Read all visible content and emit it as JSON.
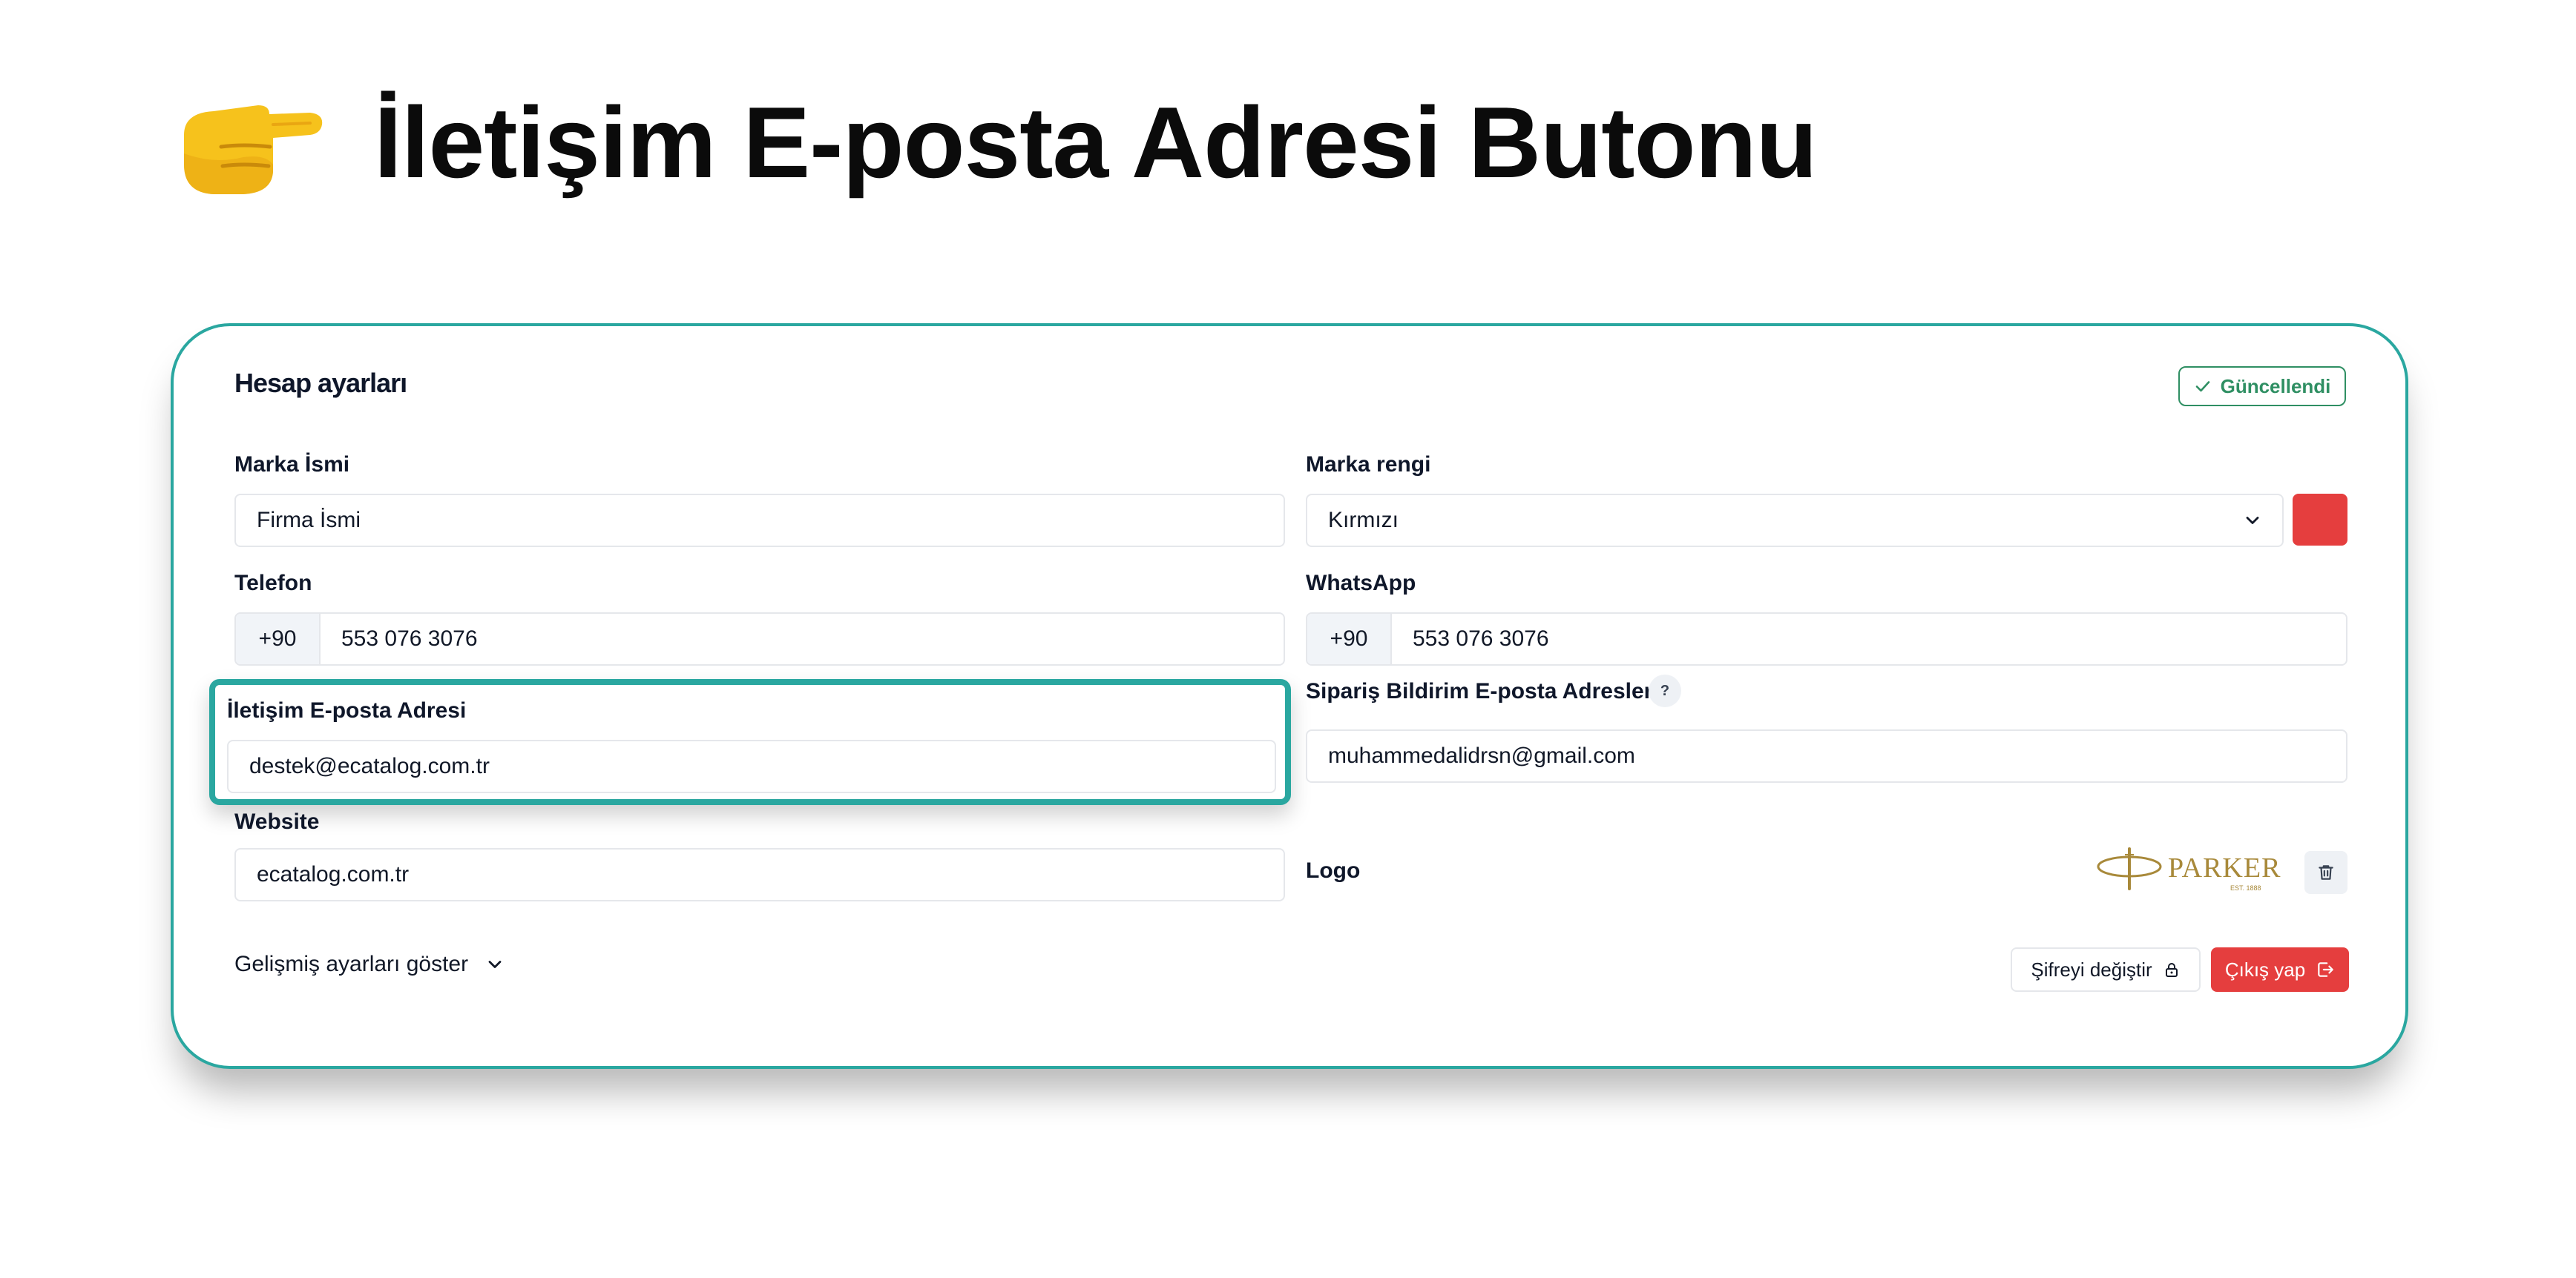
{
  "hero": {
    "title": "İletişim E-posta Adresi Butonu",
    "icon": "pointing-right-hand-icon"
  },
  "card": {
    "title": "Hesap ayarları",
    "status_label": "Güncellendi",
    "status_color": "#2f8f63",
    "accent_color": "#2aa7a0"
  },
  "fields": {
    "brand_name": {
      "label": "Marka İsmi",
      "value": "Firma İsmi"
    },
    "brand_color": {
      "label": "Marka rengi",
      "selected": "Kırmızı",
      "swatch_color": "#e53e3e"
    },
    "phone": {
      "label": "Telefon",
      "prefix": "+90",
      "value": "553 076 3076"
    },
    "whatsapp": {
      "label": "WhatsApp",
      "prefix": "+90",
      "value": "553 076 3076"
    },
    "contact_email": {
      "label": "İletişim E-posta Adresi",
      "value": "destek@ecatalog.com.tr"
    },
    "order_email": {
      "label": "Sipariş Bildirim E-posta Adresleri",
      "help": "?",
      "value": "muhammedalidrsn@gmail.com"
    },
    "website": {
      "label": "Website",
      "value": "ecatalog.com.tr"
    },
    "logo": {
      "label": "Logo",
      "brand_text": "PARKER",
      "brand_sub": "EST. 1888"
    }
  },
  "footer": {
    "advanced_label": "Gelişmiş ayarları göster",
    "change_password_label": "Şifreyi değiştir",
    "logout_label": "Çıkış yap",
    "logout_color": "#e53e3e"
  }
}
